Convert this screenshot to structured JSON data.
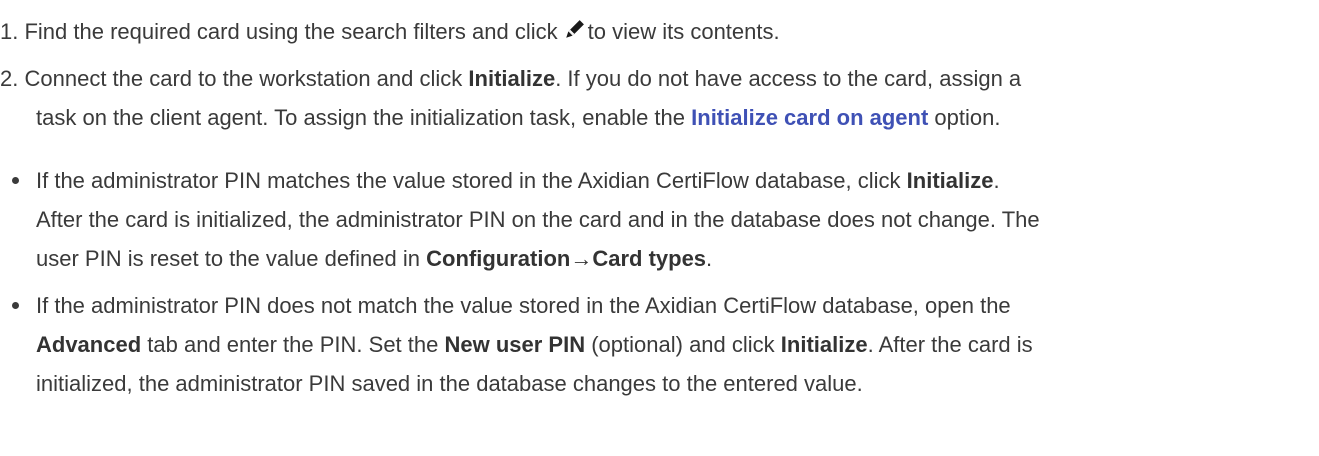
{
  "steps": [
    {
      "num": "1.",
      "part1": "Find the required card using the search filters and click",
      "part2": "to view its contents."
    },
    {
      "num": "2.",
      "p1": "Connect the card to the workstation and click",
      "b1": "Initialize",
      "p2": ". If you do not have access to the card, assign a",
      "p3": "task on the client agent. To assign the initialization task, enable the",
      "link": "Initialize card on agent",
      "p4": "option."
    }
  ],
  "bullets": [
    {
      "l1a": "If the administrator PIN matches the value stored in the Axidian CertiFlow database, click",
      "l1b": "Initialize",
      "l1c": ".",
      "l2": "After the card is initialized, the administrator PIN on the card and in the database does not change. The",
      "l3a": "user PIN is reset to the value defined in",
      "l3b": "Configuration",
      "l3arrow": "→",
      "l3c": "Card types",
      "l3d": "."
    },
    {
      "l1": "If the administrator PIN does not match the value stored in the Axidian CertiFlow database, open the",
      "l2a": "Advanced",
      "l2b": "tab and enter the PIN. Set the",
      "l2c": "New user PIN",
      "l2d": "(optional) and click",
      "l2e": "Initialize",
      "l2f": ". After the card is",
      "l3": "initialized, the administrator PIN saved in the database changes to the entered value."
    }
  ],
  "icons": {
    "edit": "pencil-icon"
  }
}
